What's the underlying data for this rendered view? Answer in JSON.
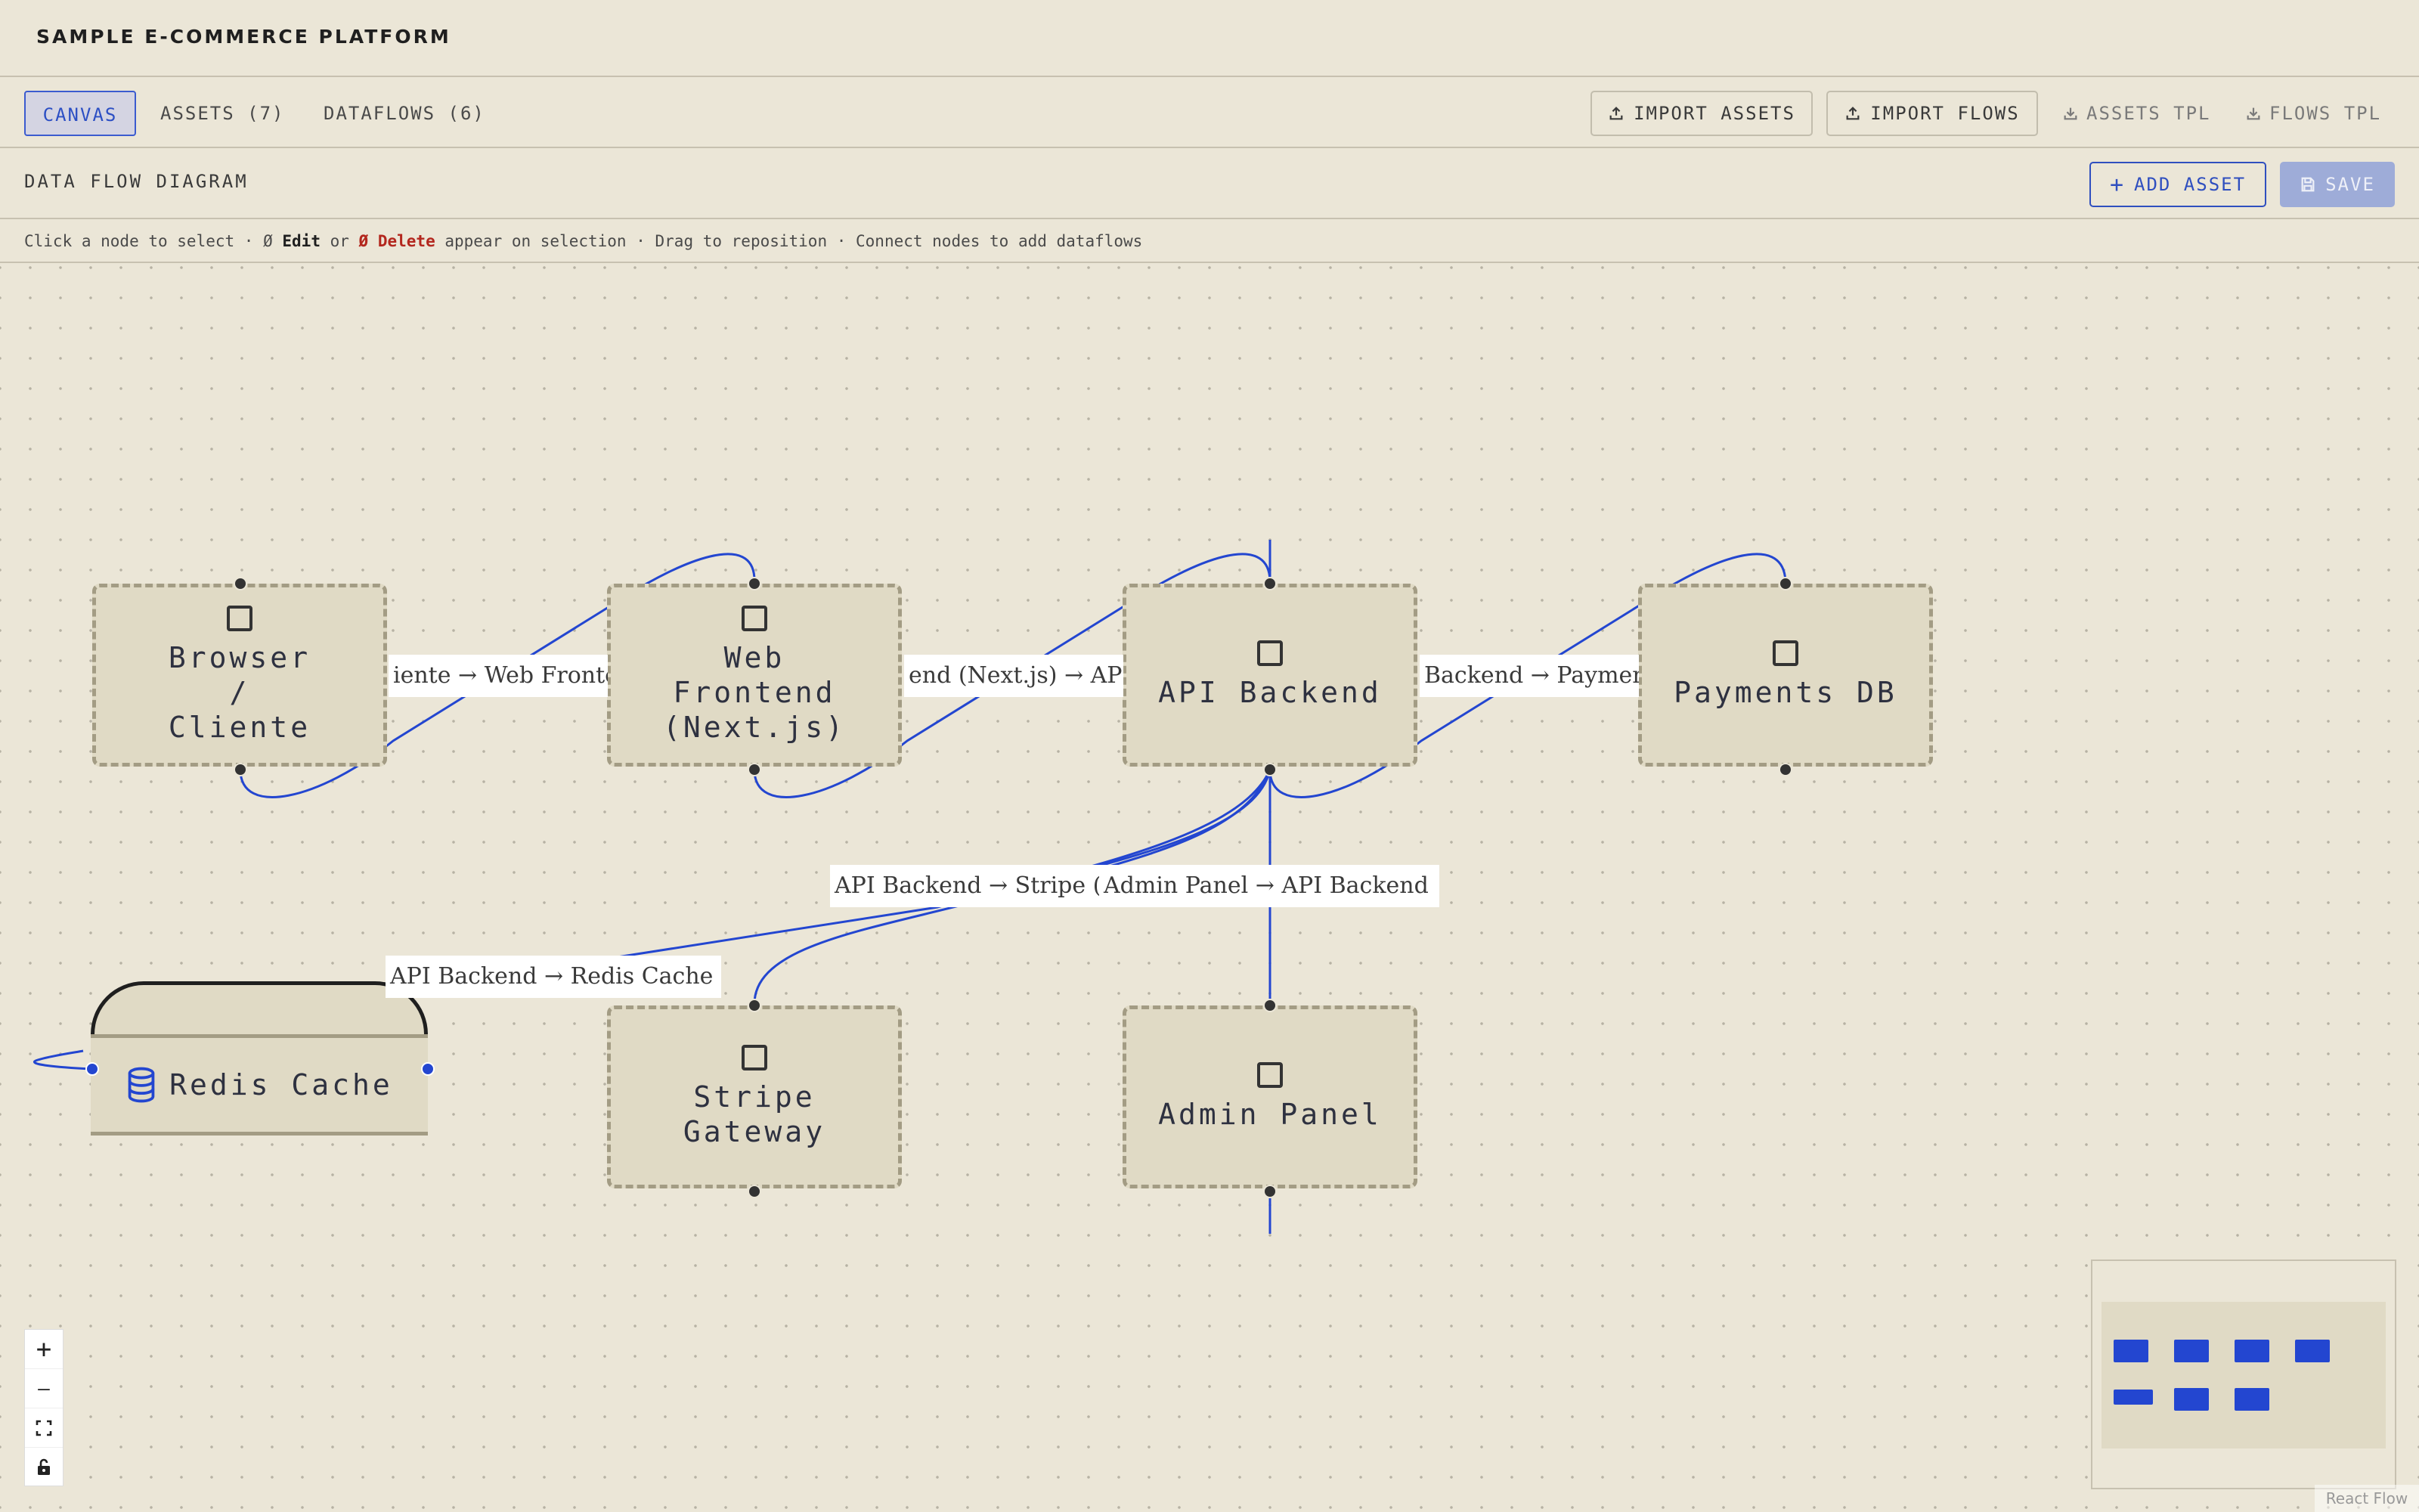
{
  "app": {
    "title": "SAMPLE E-COMMERCE PLATFORM"
  },
  "tabs": [
    {
      "label": "CANVAS",
      "active": true
    },
    {
      "label": "ASSETS (7)",
      "active": false
    },
    {
      "label": "DATAFLOWS (6)",
      "active": false
    }
  ],
  "toolbar": {
    "import_assets": "IMPORT ASSETS",
    "import_flows": "IMPORT FLOWS",
    "assets_tpl": "ASSETS TPL",
    "flows_tpl": "FLOWS TPL"
  },
  "header": {
    "title": "DATA FLOW DIAGRAM",
    "add_asset": "ADD ASSET",
    "save": "SAVE"
  },
  "hint": {
    "part1": "Click a node to select · ",
    "edit_glyph": "Ø",
    "edit": "Edit",
    "or": " or ",
    "delete_glyph": "Ø",
    "delete": "Delete",
    "part2": " appear on selection · Drag to reposition · Connect nodes to add dataflows"
  },
  "nodes": {
    "browser": "Browser / Cliente",
    "web_frontend": "Web Frontend (Next.js)",
    "api_backend": "API Backend",
    "payments_db": "Payments DB",
    "redis_cache": "Redis Cache",
    "stripe_gateway": "Stripe Gateway",
    "admin_panel": "Admin Panel"
  },
  "edge_labels": {
    "browser_web": "iente → Web Fronte",
    "web_api": "end (Next.js) → AP",
    "api_payments": "Backend → Payment",
    "api_stripe": "API Backend → Stripe (",
    "admin_api": "Admin Panel → API Backend",
    "api_redis": "API Backend → Redis Cache"
  },
  "controls": {
    "zoom_in": "+",
    "zoom_out": "—",
    "fit": "⛶",
    "lock": "🔒"
  },
  "minimap": {
    "label": "minimap"
  },
  "attribution": "React Flow",
  "colors": {
    "accent": "#2346d0",
    "background": "#ebe6d7",
    "node_fill": "#e0dac5",
    "node_border": "#a39c84",
    "delete": "#b3271e"
  }
}
